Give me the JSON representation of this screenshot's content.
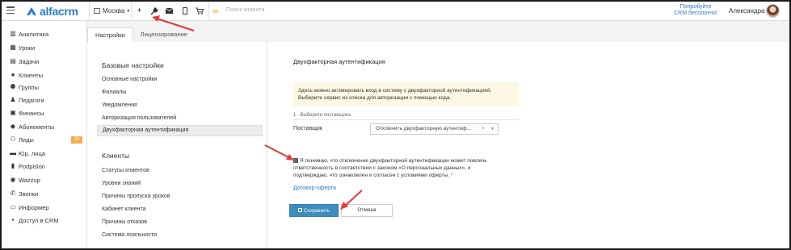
{
  "topbar": {
    "logo_text": "alfacrm",
    "branch": "Москва",
    "search_placeholder": "Поиск клиента",
    "promo_line1": "Попробуйте",
    "promo_line2": "CRM бесплатно!",
    "user_name": "Александра"
  },
  "sidebar": {
    "items": [
      {
        "label": "Аналитика",
        "icon": "chart-icon"
      },
      {
        "label": "Уроки",
        "icon": "calendar-icon"
      },
      {
        "label": "Задачи",
        "icon": "tasks-icon"
      },
      {
        "label": "Клиенты",
        "icon": "user-icon"
      },
      {
        "label": "Группы",
        "icon": "group-icon"
      },
      {
        "label": "Педагоги",
        "icon": "teacher-icon"
      },
      {
        "label": "Финансы",
        "icon": "money-icon"
      },
      {
        "label": "Абонементы",
        "icon": "tag-icon"
      },
      {
        "label": "Лиды",
        "icon": "leads-icon",
        "badge": "20"
      },
      {
        "label": "Юр. лица",
        "icon": "briefcase-icon"
      },
      {
        "label": "Podpislon",
        "icon": "podpislon-icon"
      },
      {
        "label": "Wazzup",
        "icon": "wazzup-icon"
      },
      {
        "label": "Звонки",
        "icon": "phone-icon"
      },
      {
        "label": "Информер",
        "icon": "inbox-icon"
      },
      {
        "label": "Доступ в CRM",
        "icon": "lock-icon"
      }
    ]
  },
  "tabs": [
    {
      "label": "Настройки",
      "active": true
    },
    {
      "label": "Лицензирование",
      "active": false
    }
  ],
  "settings_menu": {
    "basic_heading": "Базовые настройки",
    "basic_items": [
      "Основные настройки",
      "Филиалы",
      "Уведомления",
      "Авторизация пользователей",
      "Двухфакторная аутентификация"
    ],
    "selected_index": 4,
    "clients_heading": "Клиенты",
    "clients_items": [
      "Статусы клиентов",
      "Уровни знаний",
      "Причины пропуска уроков",
      "Кабинет клиента",
      "Причины отказов",
      "Система лояльности"
    ]
  },
  "content": {
    "title": "Двухфакторная аутентификация",
    "notice_line1": "Здесь можно активировать вход в систему с двухфакторной аутентификацией.",
    "notice_line2": "Выберите сервис из списка для авторизации с помощью кода.",
    "step_label": "1 . Выберите поставщика",
    "provider_label": "Поставщик",
    "provider_value": "Отключить двухфакторную аутентиф...",
    "agree_line1": "Я понимаю, что отключение двухфакторной аутентификации может повлечь",
    "agree_line2": "ответственность в соответствии с законом «О персональных данных», и",
    "agree_line3": "подтверждаю, что ознакомлен и согласен с условиями оферты.",
    "required_mark": "*",
    "offer_link": "Договор-оферта",
    "save_button": "Сохранить",
    "cancel_button": "Отмена"
  },
  "colors": {
    "accent": "#3c8dbc",
    "link": "#2b7bd0",
    "notice_bg": "#fcf8e3",
    "badge": "#f0ad4e",
    "annotation_arrow": "#e53935"
  }
}
